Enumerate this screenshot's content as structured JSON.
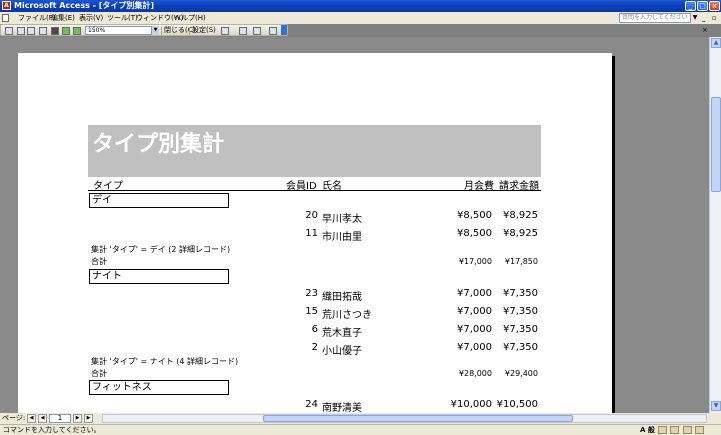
{
  "window": {
    "title": "Microsoft Access - [タイプ別集計]",
    "app_icon": "A",
    "minimize": "_",
    "maximize": "□",
    "close": "×"
  },
  "menu": {
    "items": [
      "ファイル(F)",
      "編集(E)",
      "表示(V)",
      "ツール(T)",
      "ウィンドウ(W)",
      "ヘルプ(H)"
    ],
    "help_placeholder": "質問を入力してください",
    "mdi_buttons": "_ ▫ ×"
  },
  "toolbar": {
    "zoom": "150%",
    "close_label": "閉じる(C)",
    "setup_label": "設定(S)"
  },
  "report": {
    "title": "タイプ別集計",
    "columns": {
      "type": "タイプ",
      "member_id": "会員ID",
      "name": "氏名",
      "monthly_fee": "月会費",
      "billing": "請求金額"
    },
    "groups": [
      {
        "label": "デイ",
        "rows": [
          {
            "id": "20",
            "name": "早川孝太",
            "fee": "¥8,500",
            "bill": "¥8,925"
          },
          {
            "id": "11",
            "name": "市川由里",
            "fee": "¥8,500",
            "bill": "¥8,925"
          }
        ],
        "summary": "集計 'タイプ' = デイ (2 詳細レコード)",
        "total_label": "合計",
        "total_fee": "¥17,000",
        "total_bill": "¥17,850"
      },
      {
        "label": "ナイト",
        "rows": [
          {
            "id": "23",
            "name": "織田拓哉",
            "fee": "¥7,000",
            "bill": "¥7,350"
          },
          {
            "id": "15",
            "name": "荒川さつき",
            "fee": "¥7,000",
            "bill": "¥7,350"
          },
          {
            "id": "6",
            "name": "荒木直子",
            "fee": "¥7,000",
            "bill": "¥7,350"
          },
          {
            "id": "2",
            "name": "小山優子",
            "fee": "¥7,000",
            "bill": "¥7,350"
          }
        ],
        "summary": "集計 'タイプ' = ナイト (4 詳細レコード)",
        "total_label": "合計",
        "total_fee": "¥28,000",
        "total_bill": "¥29,400"
      },
      {
        "label": "フィットネス",
        "rows": [
          {
            "id": "24",
            "name": "南野清美",
            "fee": "¥10,000",
            "bill": "¥10,500"
          }
        ]
      }
    ]
  },
  "navigation": {
    "page_label": "ページ:",
    "current_page": "1"
  },
  "status": {
    "text": "コマンドを入力してください。",
    "tray_text": "A 般"
  }
}
